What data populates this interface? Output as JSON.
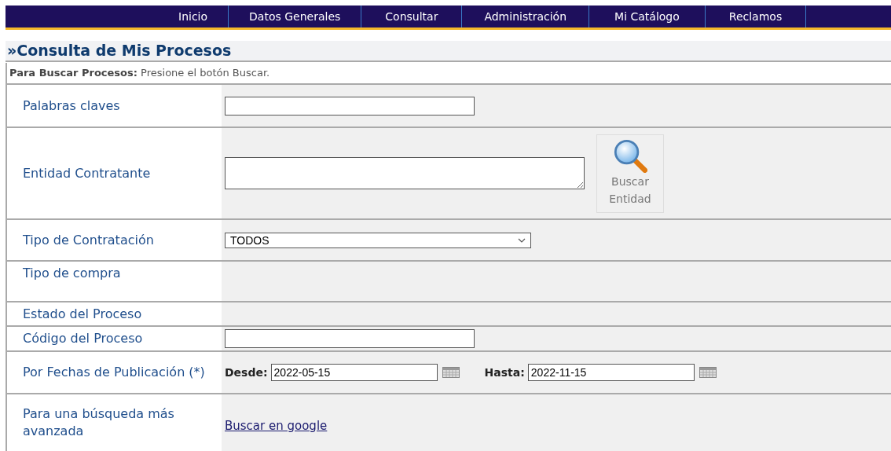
{
  "nav": [
    {
      "label": "Inicio"
    },
    {
      "label": "Datos Generales"
    },
    {
      "label": "Consultar"
    },
    {
      "label": "Administración"
    },
    {
      "label": "Mi Catálogo"
    },
    {
      "label": "Reclamos"
    }
  ],
  "title": "»Consulta de Mis Procesos",
  "info": "**Para Buscar Procesos:** Presione el botón Buscar.",
  "rows": [
    {
      "kind": "text",
      "label": "Palabras claves"
    },
    {
      "kind": "textarea",
      "label": "Entidad Contratante",
      "button": "Buscar Entidad"
    },
    {
      "kind": "select",
      "label": "Tipo de Contratación",
      "value": "TODOS"
    },
    {
      "kind": "empty",
      "label": "Tipo de compra"
    },
    {
      "kind": "empty",
      "label": "Estado del Proceso"
    },
    {
      "kind": "text",
      "label": "Código del Proceso"
    },
    {
      "kind": "dates",
      "label": "Por Fechas de Publicación (*)",
      "from_label": "Desde:",
      "from": "2022-05-15",
      "to_label": "Hasta:",
      "to": "2022-11-15"
    },
    {
      "kind": "link",
      "label": "Para una búsqueda más avanzada",
      "link": "Buscar en google"
    }
  ]
}
